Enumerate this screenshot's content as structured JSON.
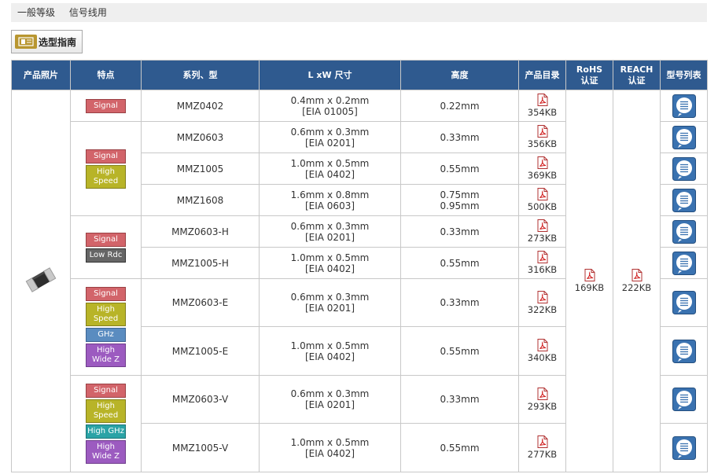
{
  "breadcrumb": [
    "一般等级",
    "信号线用"
  ],
  "guide_button": "选型指南",
  "headers": {
    "photo": "产品照片",
    "features": "特点",
    "series": "系列、型",
    "size": "L xW 尺寸",
    "height": "高度",
    "catalog": "产品目录",
    "rohs": [
      "RoHS",
      "认证"
    ],
    "reach": [
      "REACH",
      "认证"
    ],
    "part_list": "型号列表"
  },
  "tags": {
    "signal": "Signal",
    "high_speed": [
      "High",
      "Speed"
    ],
    "low_rdc": "Low Rdc",
    "ghz": "GHz",
    "high_wide_z": [
      "High",
      "Wide Z"
    ],
    "high_ghz": "High GHz"
  },
  "rows": [
    {
      "series": "MMZ0402",
      "size": [
        "0.4mm x 0.2mm",
        "[EIA 01005]"
      ],
      "height": [
        "0.22mm"
      ],
      "catalog": "354KB"
    },
    {
      "series": "MMZ0603",
      "size": [
        "0.6mm x 0.3mm",
        "[EIA 0201]"
      ],
      "height": [
        "0.33mm"
      ],
      "catalog": "356KB"
    },
    {
      "series": "MMZ1005",
      "size": [
        "1.0mm x 0.5mm",
        "[EIA 0402]"
      ],
      "height": [
        "0.55mm"
      ],
      "catalog": "369KB"
    },
    {
      "series": "MMZ1608",
      "size": [
        "1.6mm x 0.8mm",
        "[EIA 0603]"
      ],
      "height": [
        "0.75mm",
        "0.95mm"
      ],
      "catalog": "500KB"
    },
    {
      "series": "MMZ0603-H",
      "size": [
        "0.6mm x 0.3mm",
        "[EIA 0201]"
      ],
      "height": [
        "0.33mm"
      ],
      "catalog": "273KB"
    },
    {
      "series": "MMZ1005-H",
      "size": [
        "1.0mm x 0.5mm",
        "[EIA 0402]"
      ],
      "height": [
        "0.55mm"
      ],
      "catalog": "316KB"
    },
    {
      "series": "MMZ0603-E",
      "size": [
        "0.6mm x 0.3mm",
        "[EIA 0201]"
      ],
      "height": [
        "0.33mm"
      ],
      "catalog": "322KB"
    },
    {
      "series": "MMZ1005-E",
      "size": [
        "1.0mm x 0.5mm",
        "[EIA 0402]"
      ],
      "height": [
        "0.55mm"
      ],
      "catalog": "340KB"
    },
    {
      "series": "MMZ0603-V",
      "size": [
        "0.6mm x 0.3mm",
        "[EIA 0201]"
      ],
      "height": [
        "0.33mm"
      ],
      "catalog": "293KB"
    },
    {
      "series": "MMZ1005-V",
      "size": [
        "1.0mm x 0.5mm",
        "[EIA 0402]"
      ],
      "height": [
        "0.55mm"
      ],
      "catalog": "277KB"
    }
  ],
  "rohs_size": "169KB",
  "reach_size": "222KB",
  "colors": {
    "header_bg": "#2f5a8f",
    "signal": "#d2646a",
    "high_speed": "#b8b428",
    "low_rdc": "#666666",
    "ghz": "#5a8cc0",
    "high_wide_z": "#9c5bc0",
    "high_ghz": "#2aa3a6"
  },
  "icons": {
    "catalog": "pdf-icon",
    "part_list": "part-list-icon",
    "photo": "chip-component-image",
    "guide": "guide-icon"
  }
}
